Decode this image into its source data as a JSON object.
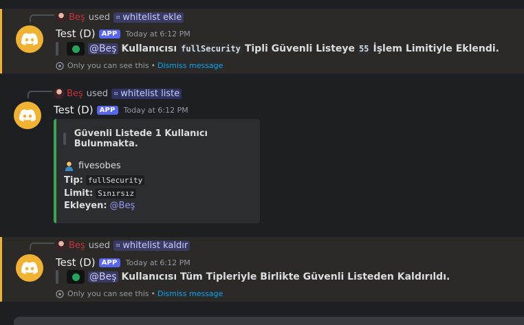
{
  "messages": [
    {
      "reply_user": "Beş",
      "reply_used": "used",
      "command": "whitelist ekle",
      "bot_name": "Test (D)",
      "app_tag": "APP",
      "timestamp": "Today at 6:12 PM",
      "mention": "@Beş",
      "text_before": "Kullanıcısı",
      "code": "fullSecurity",
      "text_mid": "Tipli Güvenli Listeye",
      "code2": "55",
      "text_after": "İşlem Limitiyle Eklendi.",
      "note": "Only you can see this",
      "note_sep": "•",
      "dismiss": "Dismiss message"
    },
    {
      "reply_user": "Beş",
      "reply_used": "used",
      "command": "whitelist liste",
      "bot_name": "Test (D)",
      "app_tag": "APP",
      "timestamp": "Today at 6:12 PM",
      "embed": {
        "quote": "Güvenli Listede 1 Kullanıcı Bulunmakta.",
        "user": "fivesobes",
        "tip_label": "Tip:",
        "tip_value": "fullSecurity",
        "limit_label": "Limit:",
        "limit_value": "Sınırsız",
        "added_label": "Ekleyen:",
        "added_value": "@Beş"
      }
    },
    {
      "reply_user": "Beş",
      "reply_used": "used",
      "command": "whitelist kaldır",
      "bot_name": "Test (D)",
      "app_tag": "APP",
      "timestamp": "Today at 6:12 PM",
      "mention": "@Beş",
      "text": "Kullanıcısı Tüm Tipleriyle Birlikte Güvenli Listeden Kaldırıldı.",
      "note": "Only you can see this",
      "note_sep": "•",
      "dismiss": "Dismiss message"
    }
  ],
  "colors": {
    "ephemeral_border": "#f0b232",
    "embed_border": "#3ba55c",
    "app_tag": "#5865f2",
    "link": "#00a8fc",
    "avatar": "#f0b232"
  },
  "icons": {
    "bot_avatar": "discord-logo-icon",
    "status": "online-dot-icon",
    "ephemeral": "eye-icon",
    "command": "slash-command-icon",
    "person": "person-emoji-icon"
  }
}
